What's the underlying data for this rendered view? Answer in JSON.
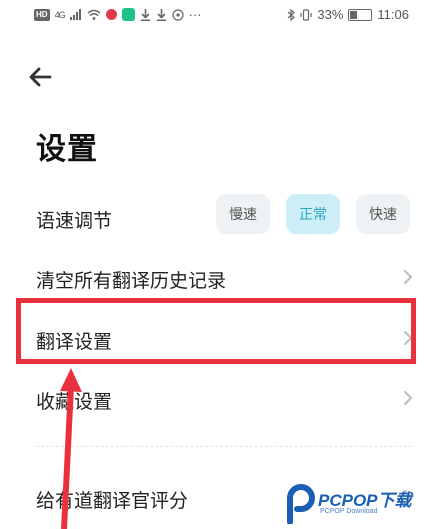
{
  "status_bar": {
    "hd": "HD",
    "signal": "4G",
    "battery_text": "33%",
    "battery_level": 0.33,
    "time": "11:06",
    "more": "···"
  },
  "header": {
    "back_icon": "arrow-left-icon",
    "title": "设置"
  },
  "settings": {
    "speech_speed": {
      "label": "语速调节",
      "options": [
        "慢速",
        "正常",
        "快速"
      ],
      "selected": "正常"
    },
    "items": [
      {
        "label": "清空所有翻译历史记录"
      },
      {
        "label": "翻译设置"
      },
      {
        "label": "收藏设置"
      },
      {
        "label": "给有道翻译官评分"
      }
    ]
  },
  "watermark": {
    "brand": "PCPOP下载",
    "sub": "PCPOP Download"
  },
  "colors": {
    "accent": "#2aa6c4",
    "accent_bg": "#cdeef6",
    "highlight": "#e8313d"
  }
}
